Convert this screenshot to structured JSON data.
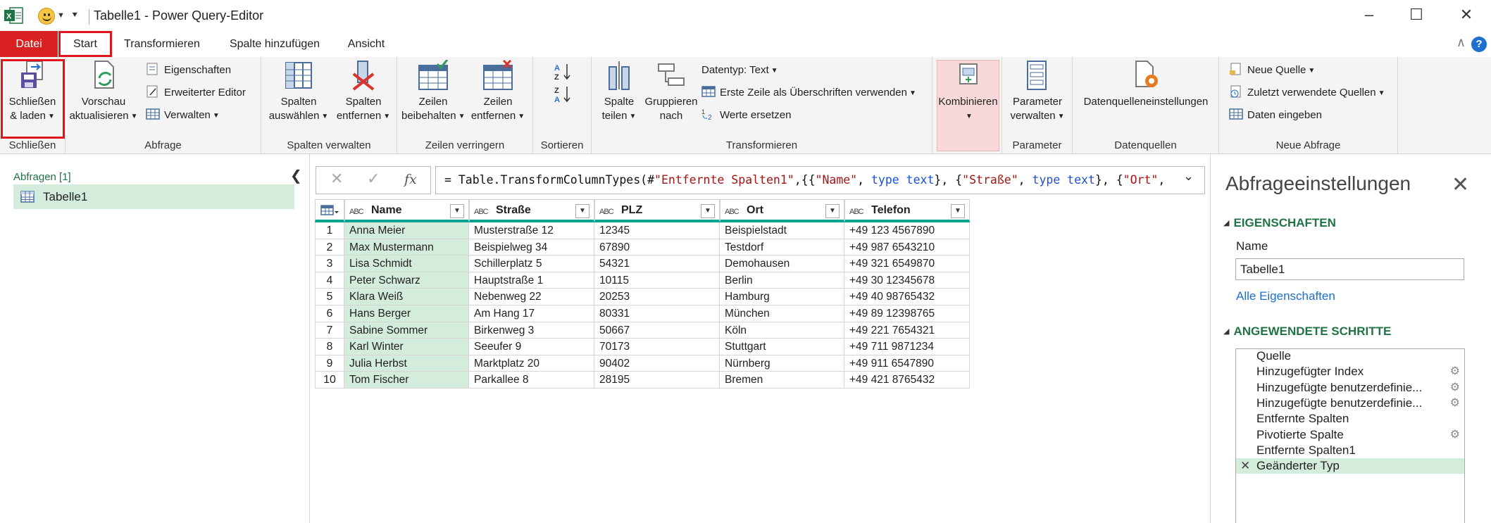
{
  "window": {
    "title": "Tabelle1 - Power Query-Editor",
    "min_icon": "minimize-icon",
    "max_icon": "maximize-icon",
    "close_icon": "close-icon"
  },
  "tabs": [
    {
      "label": "Datei"
    },
    {
      "label": "Start"
    },
    {
      "label": "Transformieren"
    },
    {
      "label": "Spalte hinzufügen"
    },
    {
      "label": "Ansicht"
    }
  ],
  "ribbon": {
    "close": {
      "line1": "Schließen",
      "line2": "& laden",
      "group": "Schließen"
    },
    "query": {
      "preview_line1": "Vorschau",
      "preview_line2": "aktualisieren",
      "properties": "Eigenschaften",
      "advanced_editor": "Erweiterter Editor",
      "manage": "Verwalten",
      "group": "Abfrage"
    },
    "columns": {
      "choose_line1": "Spalten",
      "choose_line2": "auswählen",
      "remove_line1": "Spalten",
      "remove_line2": "entfernen",
      "group": "Spalten verwalten"
    },
    "rows": {
      "keep_line1": "Zeilen",
      "keep_line2": "beibehalten",
      "remove_line1": "Zeilen",
      "remove_line2": "entfernen",
      "group": "Zeilen verringern"
    },
    "sort": {
      "group": "Sortieren"
    },
    "transform": {
      "split_line1": "Spalte",
      "split_line2": "teilen",
      "group_line1": "Gruppieren",
      "group_line2": "nach",
      "datatype": "Datentyp: Text",
      "first_row": "Erste Zeile als Überschriften verwenden",
      "replace": "Werte ersetzen",
      "group": "Transformieren"
    },
    "combine": {
      "label": "Kombinieren"
    },
    "params": {
      "line1": "Parameter",
      "line2": "verwalten",
      "group": "Parameter"
    },
    "datasource": {
      "label": "Datenquelleneinstellungen",
      "group": "Datenquellen"
    },
    "newquery": {
      "new_source": "Neue Quelle",
      "recent": "Zuletzt verwendete Quellen",
      "enter_data": "Daten eingeben",
      "group": "Neue Abfrage"
    }
  },
  "queries": {
    "header": "Abfragen [1]",
    "items": [
      {
        "label": "Tabelle1"
      }
    ]
  },
  "formula": {
    "parts": [
      {
        "t": "plain",
        "v": "= Table.TransformColumnTypes(#"
      },
      {
        "t": "str",
        "v": "\"Entfernte Spalten1\""
      },
      {
        "t": "plain",
        "v": ",{{"
      },
      {
        "t": "str",
        "v": "\"Name\""
      },
      {
        "t": "plain",
        "v": ", "
      },
      {
        "t": "kw",
        "v": "type text"
      },
      {
        "t": "plain",
        "v": "}, {"
      },
      {
        "t": "str",
        "v": "\"Straße\""
      },
      {
        "t": "plain",
        "v": ", "
      },
      {
        "t": "kw",
        "v": "type text"
      },
      {
        "t": "plain",
        "v": "}, {"
      },
      {
        "t": "str",
        "v": "\"Ort\""
      },
      {
        "t": "plain",
        "v": ","
      }
    ]
  },
  "table": {
    "type_label": "ABC",
    "columns": [
      "Name",
      "Straße",
      "PLZ",
      "Ort",
      "Telefon"
    ],
    "rows": [
      {
        "n": "1",
        "cells": [
          "Anna Meier",
          "Musterstraße 12",
          "12345",
          "Beispielstadt",
          "+49 123 4567890"
        ]
      },
      {
        "n": "2",
        "cells": [
          "Max Mustermann",
          "Beispielweg 34",
          "67890",
          "Testdorf",
          "+49 987 6543210"
        ]
      },
      {
        "n": "3",
        "cells": [
          "Lisa Schmidt",
          "Schillerplatz 5",
          "54321",
          "Demohausen",
          "+49 321 6549870"
        ]
      },
      {
        "n": "4",
        "cells": [
          "Peter Schwarz",
          "Hauptstraße 1",
          "10115",
          "Berlin",
          "+49 30 12345678"
        ]
      },
      {
        "n": "5",
        "cells": [
          "Klara Weiß",
          "Nebenweg 22",
          "20253",
          "Hamburg",
          "+49 40 98765432"
        ]
      },
      {
        "n": "6",
        "cells": [
          "Hans Berger",
          "Am Hang 17",
          "80331",
          "München",
          "+49 89 12398765"
        ]
      },
      {
        "n": "7",
        "cells": [
          "Sabine Sommer",
          "Birkenweg 3",
          "50667",
          "Köln",
          "+49 221 7654321"
        ]
      },
      {
        "n": "8",
        "cells": [
          "Karl Winter",
          "Seeufer 9",
          "70173",
          "Stuttgart",
          "+49 711 9871234"
        ]
      },
      {
        "n": "9",
        "cells": [
          "Julia Herbst",
          "Marktplatz 20",
          "90402",
          "Nürnberg",
          "+49 911 6547890"
        ]
      },
      {
        "n": "10",
        "cells": [
          "Tom Fischer",
          "Parkallee 8",
          "28195",
          "Bremen",
          "+49 421 8765432"
        ]
      }
    ]
  },
  "settings": {
    "title": "Abfrageeinstellungen",
    "properties_header": "EIGENSCHAFTEN",
    "name_label": "Name",
    "name_value": "Tabelle1",
    "all_properties": "Alle Eigenschaften",
    "steps_header": "ANGEWENDETE SCHRITTE",
    "steps": [
      {
        "label": "Quelle",
        "gear": false,
        "active": false
      },
      {
        "label": "Hinzugefügter Index",
        "gear": true,
        "active": false
      },
      {
        "label": "Hinzugefügte benutzerdefinie...",
        "gear": true,
        "active": false
      },
      {
        "label": "Hinzugefügte benutzerdefinie...",
        "gear": true,
        "active": false
      },
      {
        "label": "Entfernte Spalten",
        "gear": false,
        "active": false
      },
      {
        "label": "Pivotierte Spalte",
        "gear": true,
        "active": false
      },
      {
        "label": "Entfernte Spalten1",
        "gear": false,
        "active": false
      },
      {
        "label": "Geänderter Typ",
        "gear": false,
        "active": true
      }
    ]
  },
  "colors": {
    "accent_green": "#217346",
    "selection_green": "#d3ecdc",
    "header_teal": "#00a38f",
    "highlight_red": "#e0141d",
    "file_tab_red": "#d92121"
  }
}
